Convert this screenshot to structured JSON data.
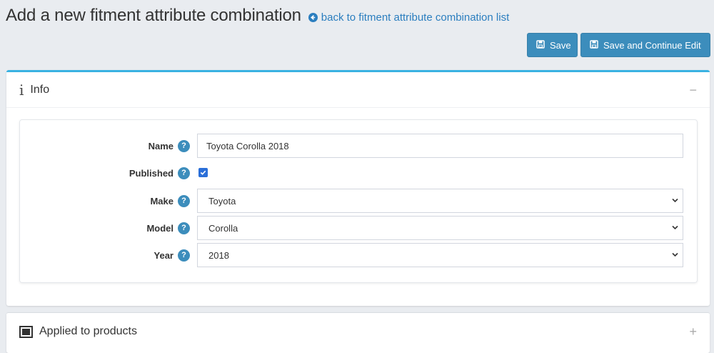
{
  "header": {
    "title": "Add a new fitment attribute combination",
    "back_link": "back to fitment attribute combination list"
  },
  "toolbar": {
    "save_label": "Save",
    "save_continue_label": "Save and Continue Edit"
  },
  "info_panel": {
    "title": "Info",
    "toggle": "−",
    "fields": {
      "name": {
        "label": "Name",
        "value": "Toyota Corolla 2018"
      },
      "published": {
        "label": "Published",
        "checked": true
      },
      "make": {
        "label": "Make",
        "value": "Toyota"
      },
      "model": {
        "label": "Model",
        "value": "Corolla"
      },
      "year": {
        "label": "Year",
        "value": "2018"
      }
    },
    "help_glyph": "?"
  },
  "applied_panel": {
    "title": "Applied to products",
    "toggle": "+"
  },
  "colors": {
    "accent": "#3c8dbc",
    "panel_top_border": "#3ab2e2",
    "background": "#e9ecf0"
  },
  "icons": [
    "arrow-left-icon",
    "floppy-disk-icon",
    "info-icon",
    "help-icon",
    "chevron-down-icon",
    "products-icon"
  ]
}
